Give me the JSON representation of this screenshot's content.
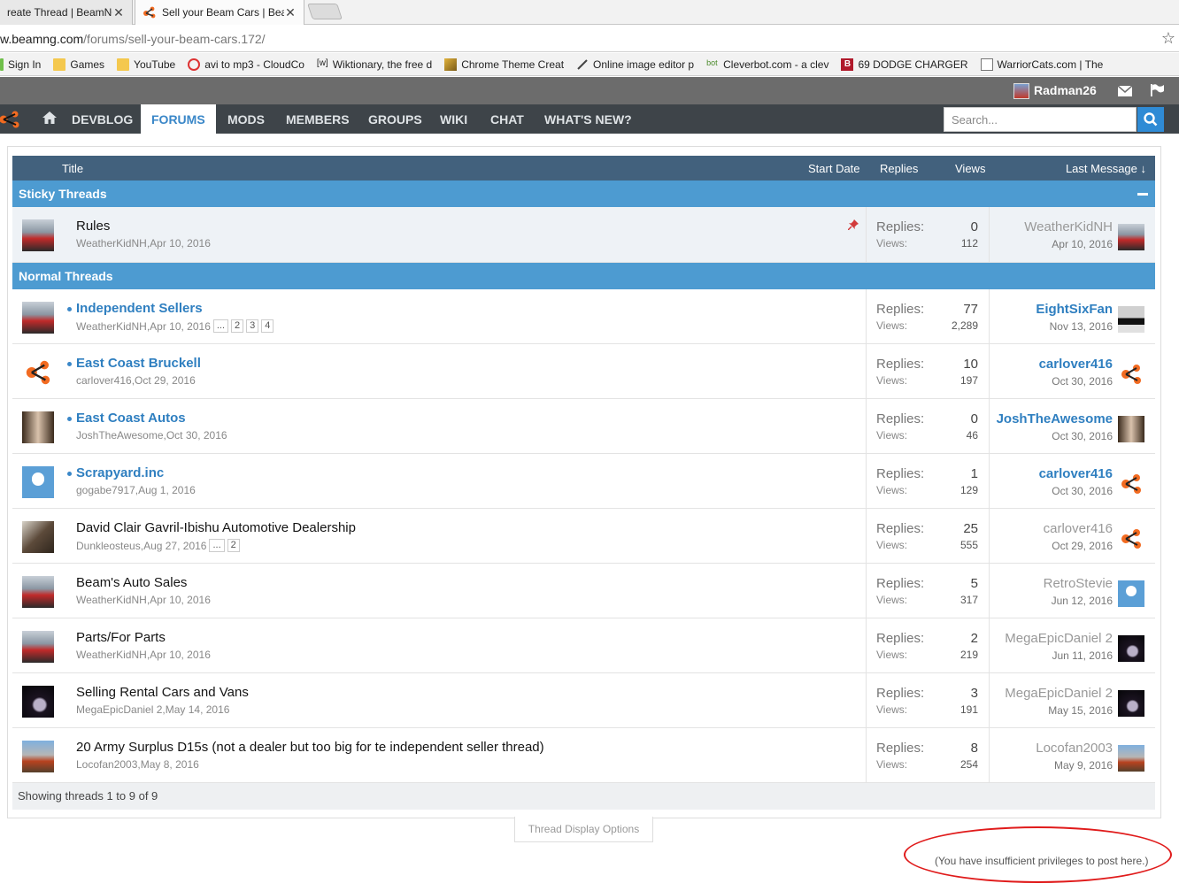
{
  "browser": {
    "tabs": [
      {
        "label": "reate Thread | BeamNG",
        "active": false
      },
      {
        "label": "Sell your Beam Cars | Bea",
        "active": true
      }
    ],
    "url_host": "w.beamng.com",
    "url_path": "/forums/sell-your-beam-cars.172/",
    "bookmarks": [
      {
        "label": "Sign In",
        "icon": "folder-green-icon"
      },
      {
        "label": "Games",
        "icon": "folder-icon"
      },
      {
        "label": "YouTube",
        "icon": "folder-icon"
      },
      {
        "label": "avi to mp3 - CloudCo",
        "icon": "cloudconvert-icon"
      },
      {
        "label": "Wiktionary, the free d",
        "icon": "wiktionary-icon"
      },
      {
        "label": "Chrome Theme Creat",
        "icon": "theme-icon"
      },
      {
        "label": "Online image editor p",
        "icon": "pencil-icon"
      },
      {
        "label": "Cleverbot.com - a clev",
        "icon": "bot-icon"
      },
      {
        "label": "69 DODGE CHARGER",
        "icon": "b-icon"
      },
      {
        "label": "WarriorCats.com | The",
        "icon": "page-icon"
      }
    ]
  },
  "header": {
    "username": "Radman26",
    "nav": [
      "DEVBLOG",
      "FORUMS",
      "MODS",
      "MEMBERS",
      "GROUPS",
      "WIKI",
      "CHAT",
      "WHAT'S NEW?"
    ],
    "active_nav": "FORUMS",
    "search_placeholder": "Search..."
  },
  "table": {
    "columns": {
      "title": "Title",
      "start_date": "Start Date",
      "replies": "Replies",
      "views": "Views",
      "last_message": "Last Message ↓"
    },
    "stat_labels": {
      "replies": "Replies:",
      "views": "Views:"
    },
    "sticky_label": "Sticky Threads",
    "normal_label": "Normal Threads",
    "sticky": [
      {
        "title": "Rules",
        "author": "WeatherKidNH",
        "date": "Apr 10, 2016",
        "replies": "0",
        "views": "112",
        "last_user": "WeatherKidNH",
        "last_date": "Apr 10, 2016",
        "avatar": "car",
        "last_avatar": "car"
      }
    ],
    "threads": [
      {
        "title": "Independent Sellers",
        "unread": true,
        "author": "WeatherKidNH",
        "date": "Apr 10, 2016",
        "pages": [
          "...",
          "2",
          "3",
          "4"
        ],
        "replies": "77",
        "views": "2,289",
        "last_user": "EightSixFan",
        "last_date": "Nov 13, 2016",
        "avatar": "car",
        "last_avatar": "road"
      },
      {
        "title": "East Coast Bruckell",
        "unread": true,
        "author": "carlover416",
        "date": "Oct 29, 2016",
        "pages": [],
        "replies": "10",
        "views": "197",
        "last_user": "carlover416",
        "last_date": "Oct 30, 2016",
        "avatar": "logo",
        "last_avatar": "logo"
      },
      {
        "title": "East Coast Autos",
        "unread": true,
        "author": "JoshTheAwesome",
        "date": "Oct 30, 2016",
        "pages": [],
        "replies": "0",
        "views": "46",
        "last_user": "JoshTheAwesome",
        "last_date": "Oct 30, 2016",
        "avatar": "girl",
        "last_avatar": "girl"
      },
      {
        "title": "Scrapyard.inc",
        "unread": true,
        "author": "gogabe7917",
        "date": "Aug 1, 2016",
        "pages": [],
        "replies": "1",
        "views": "129",
        "last_user": "carlover416",
        "last_date": "Oct 30, 2016",
        "avatar": "blue",
        "last_avatar": "logo"
      },
      {
        "title": "David Clair Gavril-Ibishu Automotive Dealership",
        "unread": false,
        "author": "Dunkleosteus",
        "date": "Aug 27, 2016",
        "pages": [
          "...",
          "2"
        ],
        "replies": "25",
        "views": "555",
        "last_user": "carlover416",
        "last_date": "Oct 29, 2016",
        "avatar": "dino",
        "last_avatar": "logo"
      },
      {
        "title": "Beam's Auto Sales",
        "unread": false,
        "author": "WeatherKidNH",
        "date": "Apr 10, 2016",
        "pages": [],
        "replies": "5",
        "views": "317",
        "last_user": "RetroStevie",
        "last_date": "Jun 12, 2016",
        "avatar": "car",
        "last_avatar": "blue"
      },
      {
        "title": "Parts/For Parts",
        "unread": false,
        "author": "WeatherKidNH",
        "date": "Apr 10, 2016",
        "pages": [],
        "replies": "2",
        "views": "219",
        "last_user": "MegaEpicDaniel 2",
        "last_date": "Jun 11, 2016",
        "avatar": "car",
        "last_avatar": "dark"
      },
      {
        "title": "Selling Rental Cars and Vans",
        "unread": false,
        "author": "MegaEpicDaniel 2",
        "date": "May 14, 2016",
        "pages": [],
        "replies": "3",
        "views": "191",
        "last_user": "MegaEpicDaniel 2",
        "last_date": "May 15, 2016",
        "avatar": "dark",
        "last_avatar": "dark"
      },
      {
        "title": "20 Army Surplus D15s (not a dealer but too big for te independent seller thread)",
        "unread": false,
        "author": "Locofan2003",
        "date": "May 8, 2016",
        "pages": [],
        "replies": "8",
        "views": "254",
        "last_user": "Locofan2003",
        "last_date": "May 9, 2016",
        "avatar": "rust",
        "last_avatar": "rust"
      }
    ],
    "showing": "Showing threads 1 to 9 of 9"
  },
  "footer": {
    "display_options": "Thread Display Options",
    "no_privileges": "(You have insufficient privileges to post here.)"
  },
  "colors": {
    "nav_bg": "#3e4449",
    "section_bg": "#4d9bd1",
    "header_bg": "#42617d",
    "link": "#2f7fc0",
    "annotation": "#e01b1b",
    "brand": "#f26b21"
  }
}
